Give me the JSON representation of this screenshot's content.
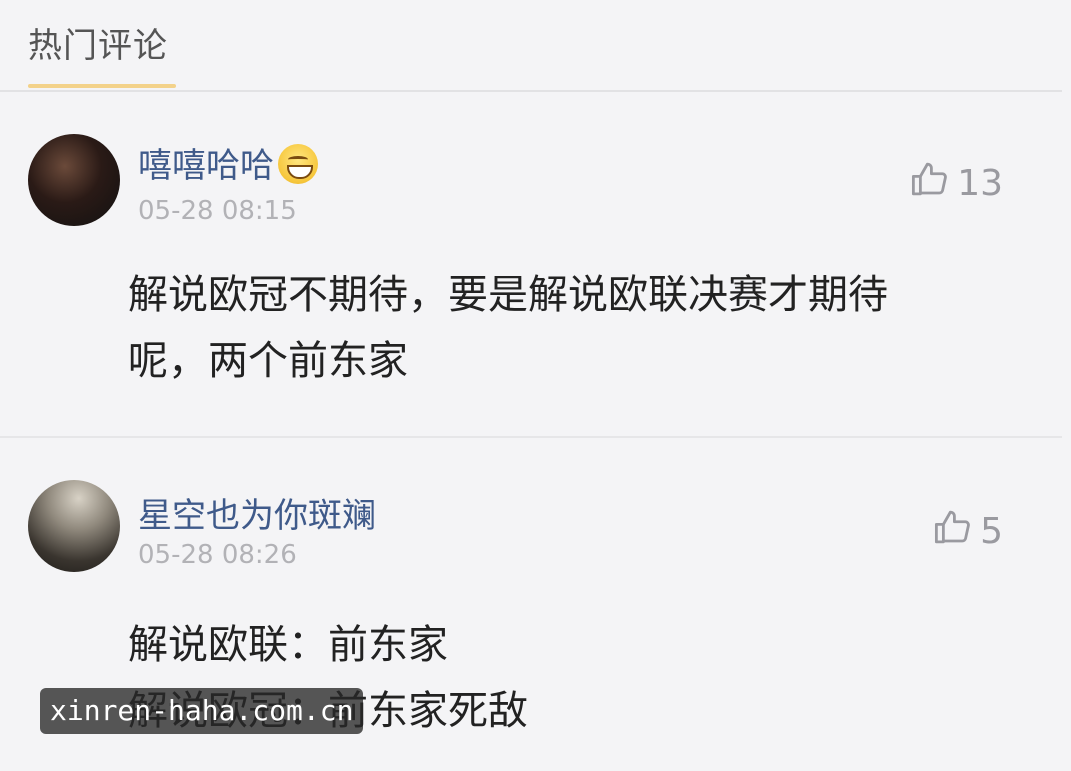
{
  "header": {
    "active_tab": "热门评论"
  },
  "comments": [
    {
      "username": "嘻嘻哈哈",
      "emoji": "grinning-face-emoji",
      "timestamp": "05-28 08:15",
      "likes": "13",
      "content_line1": "解说欧冠不期待，要是解说欧联决赛才期待",
      "content_line2": "呢，两个前东家"
    },
    {
      "username": "星空也为你斑斓",
      "timestamp": "05-28 08:26",
      "likes": "5",
      "content_line1": "解说欧联：前东家",
      "content_line2": "解说欧冠：前东家死敌"
    }
  ],
  "watermark": "xinren-haha.com.cn",
  "colors": {
    "username": "#3f5a8a",
    "timestamp": "#b2b2b6",
    "tab_underline": "#f3d28a"
  }
}
